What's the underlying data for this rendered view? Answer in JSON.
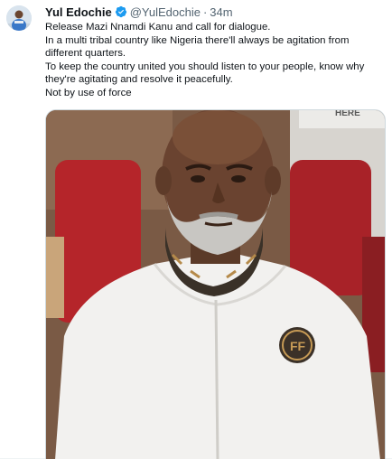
{
  "author": {
    "display_name": "Yul Edochie",
    "handle": "@YulEdochie",
    "separator": "·",
    "time": "34m",
    "verified": true,
    "verified_color": "#1d9bf0"
  },
  "tweet": {
    "lines": [
      "Release Mazi Nnamdi Kanu and call for dialogue.",
      "In a multi tribal country like Nigeria there'll always be agitation from different quarters.",
      "To keep the country united you should listen to your people, know why they're agitating and resolve it peacefully.",
      "Not by use of force"
    ]
  },
  "media": {
    "sign_text": "HERE"
  },
  "colors": {
    "text": "#0f1419",
    "secondary": "#536471",
    "accent": "#1d9bf0"
  }
}
